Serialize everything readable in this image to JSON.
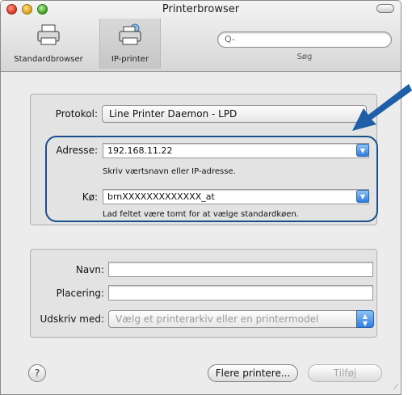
{
  "window": {
    "title": "Printerbrowser"
  },
  "toolbar": {
    "standard_label": "Standardbrowser",
    "ip_label": "IP-printer",
    "search_placeholder": "Q-",
    "search_label": "Søg"
  },
  "protocol": {
    "label": "Protokol:",
    "value": "Line Printer Daemon - LPD"
  },
  "address": {
    "label": "Adresse:",
    "value": "192.168.11.22",
    "hint": "Skriv værtsnavn eller IP-adresse."
  },
  "queue": {
    "label": "Kø:",
    "value": "brnXXXXXXXXXXXXX_at",
    "hint": "Lad feltet være tomt for at vælge standardkøen."
  },
  "info": {
    "name_label": "Navn:",
    "name_value": "",
    "location_label": "Placering:",
    "location_value": "",
    "printwith_label": "Udskriv med:",
    "printwith_value": "Vælg et printerarkiv eller en printermodel"
  },
  "footer": {
    "help_label": "?",
    "more_printers_label": "Flere printere...",
    "add_label": "Tilføj"
  },
  "colors": {
    "highlight": "#1a4f8e",
    "arrow": "#1f5fa8",
    "accent": "#2f7ee0"
  }
}
